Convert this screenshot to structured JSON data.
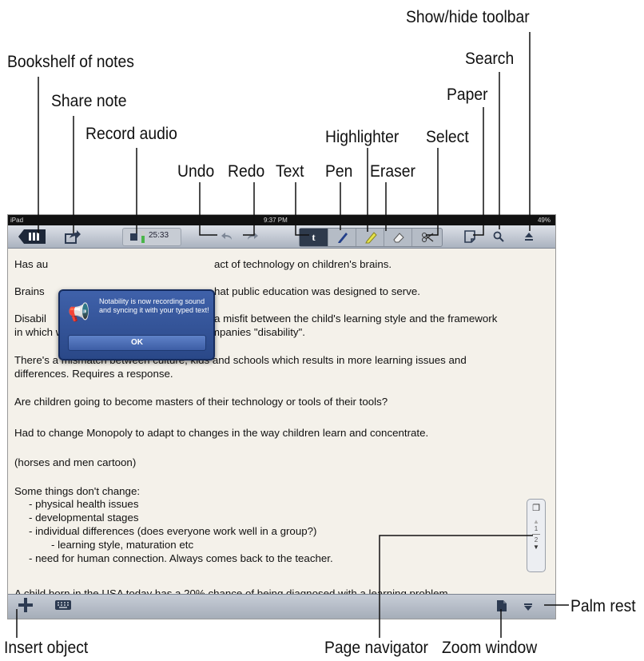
{
  "callouts": {
    "show_hide_toolbar": "Show/hide toolbar",
    "search": "Search",
    "bookshelf": "Bookshelf of notes",
    "paper": "Paper",
    "share_note": "Share note",
    "record_audio": "Record audio",
    "highlighter": "Highlighter",
    "select": "Select",
    "undo": "Undo",
    "redo": "Redo",
    "text": "Text",
    "pen": "Pen",
    "eraser": "Eraser",
    "palm_rest": "Palm rest",
    "insert_object": "Insert object",
    "page_navigator": "Page navigator",
    "zoom_window": "Zoom window"
  },
  "status_bar": {
    "carrier": "iPad",
    "time": "9:37 PM",
    "battery": "49%"
  },
  "recorder": {
    "elapsed": "25:33"
  },
  "popup": {
    "message": "Notability is now recording sound and syncing it with your typed text!",
    "ok_label": "OK"
  },
  "note_lines": [
    "Has au",
    "act of technology on children's brains.",
    "Brains",
    "hat public education was designed to serve.",
    "Disabil",
    "a misfit between the child's learning style and the framework",
    "in which we teach them. Talent often accompanies \"disability\".",
    "There's a mismatch between culture, kids and schools which results in more learning issues and",
    "differences. Requires a response.",
    "Are children going to become masters of their technology or tools of their tools?",
    "Had to change Monopoly to adapt to changes in the way children learn and concentrate.",
    "(horses and men cartoon)",
    "Some things don't change:",
    "- physical health issues",
    "- developmental stages",
    "- individual differences (does everyone work well in a group?)",
    "- learning style, maturation etc",
    "- need for human connection.  Always comes back to the teacher.",
    "A child born in the USA today has a 20% chance of being diagnosed with a learning problem"
  ],
  "page_nav": {
    "page_a": "1",
    "page_b": "2"
  },
  "icons": [
    "bookshelf-icon",
    "share-icon",
    "stop-icon",
    "undo-icon",
    "redo-icon",
    "text-tool-icon",
    "pen-icon",
    "highlighter-icon",
    "eraser-icon",
    "scissors-icon",
    "paper-icon",
    "search-icon",
    "eject-icon",
    "megaphone-icon",
    "pages-icon",
    "plus-icon",
    "keyboard-icon",
    "zoom-window-icon",
    "palm-rest-icon"
  ]
}
